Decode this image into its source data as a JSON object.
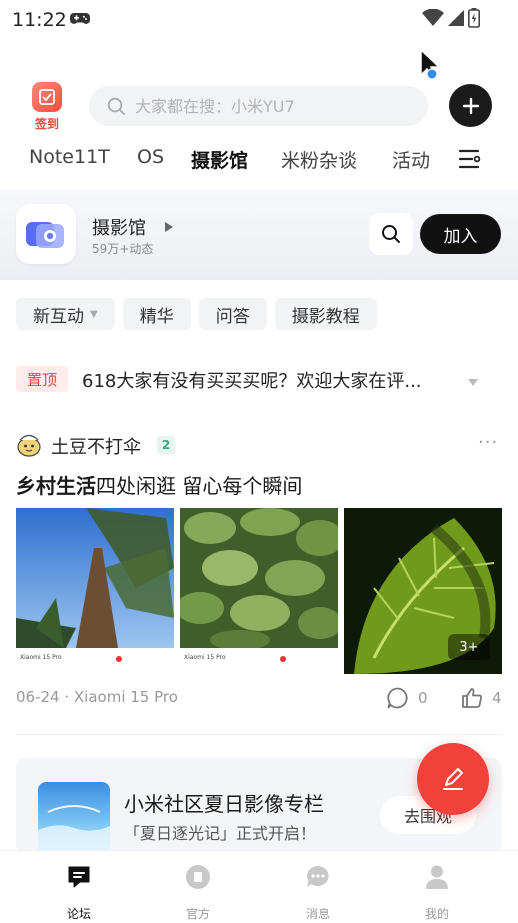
{
  "status_bar": {
    "time": "11:22"
  },
  "header": {
    "checkin_label": "签到",
    "search_placeholder": "大家都在搜：小米YU7"
  },
  "tabs": [
    {
      "label": "Note11T"
    },
    {
      "label": "OS"
    },
    {
      "label": "摄影馆",
      "active": true
    },
    {
      "label": "米粉杂谈"
    },
    {
      "label": "活动"
    }
  ],
  "forum": {
    "name": "摄影馆",
    "subtitle": "59万+动态",
    "join_label": "加入"
  },
  "filters": [
    "新互动",
    "精华",
    "问答",
    "摄影教程"
  ],
  "pinned": {
    "tag": "置顶",
    "text": "618大家有没有买买买呢？欢迎大家在评..."
  },
  "post": {
    "author": "土豆不打伞",
    "level": "2",
    "title_bold": "乡村生活",
    "title_rest": "四处闲逛 留心每个瞬间",
    "more_photos": "3+",
    "meta": "06-24 · Xiaomi 15 Pro",
    "comments": "0",
    "likes": "4",
    "captions": [
      "Xiaomi 15 Pro",
      "Xiaomi 15 Pro"
    ]
  },
  "promo": {
    "title": "小米社区夏日影像专栏",
    "subtitle": "「夏日逐光记」正式开启！",
    "button": "去围观"
  },
  "bottom_nav": [
    {
      "label": "论坛",
      "active": true
    },
    {
      "label": "官方"
    },
    {
      "label": "消息"
    },
    {
      "label": "我的"
    }
  ],
  "colors": {
    "accent": "#f2413a",
    "dark": "#111111",
    "level_green": "#2bb07f"
  }
}
